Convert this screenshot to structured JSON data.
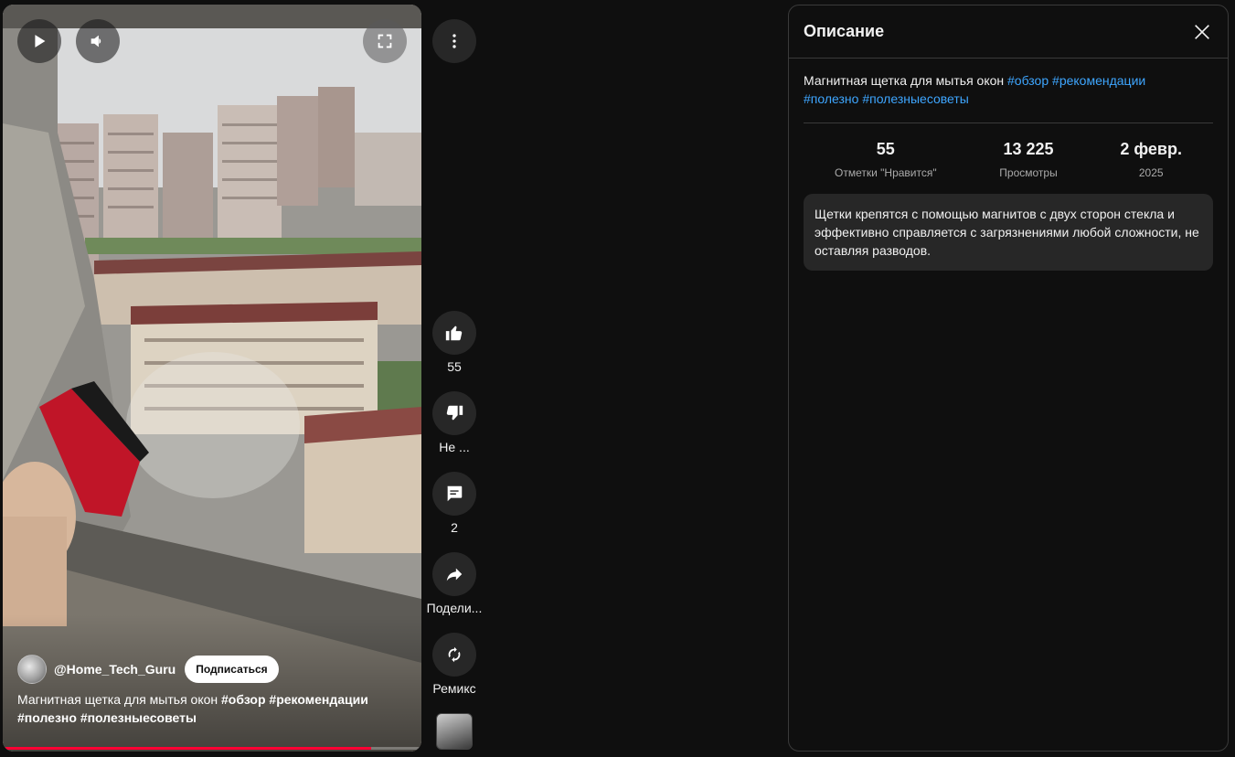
{
  "player": {
    "channel_handle": "@Home_Tech_Guru",
    "subscribe_label": "Подписаться",
    "caption_text": "Магнитная щетка для мытья окон ",
    "caption_hashtags": [
      "#обзор",
      "#рекомендации",
      "#полезно",
      "#полезныесоветы"
    ],
    "progress_fraction": 0.88,
    "icons": {
      "play": "play-icon",
      "volume": "volume-icon",
      "fullscreen": "fullscreen-icon"
    }
  },
  "rail": {
    "like_count": "55",
    "dislike_label": "Не ...",
    "comment_count": "2",
    "share_label": "Подели...",
    "remix_label": "Ремикс",
    "icons": {
      "more": "more-vertical-icon",
      "like": "thumbs-up-icon",
      "dislike": "thumbs-down-icon",
      "comment": "comment-icon",
      "share": "share-icon",
      "remix": "remix-icon"
    }
  },
  "panel": {
    "title": "Описание",
    "desc_text": "Магнитная щетка для мытья окон ",
    "hashtags": [
      "#обзор",
      "#рекомендации",
      "#полезно",
      "#полезныесоветы"
    ],
    "stats": [
      {
        "value": "55",
        "label": "Отметки \"Нравится\""
      },
      {
        "value": "13 225",
        "label": "Просмотры"
      },
      {
        "value": "2 февр.",
        "label": "2025"
      }
    ],
    "description": "Щетки крепятся с помощью магнитов с двух сторон стекла и эффективно справляется с загрязнениями любой сложности, не оставляя разводов.",
    "icons": {
      "close": "close-icon"
    }
  },
  "colors": {
    "accent_link": "#3ea6ff",
    "progress": "#ff0033",
    "background": "#0f0f0f",
    "surface": "#272727"
  }
}
